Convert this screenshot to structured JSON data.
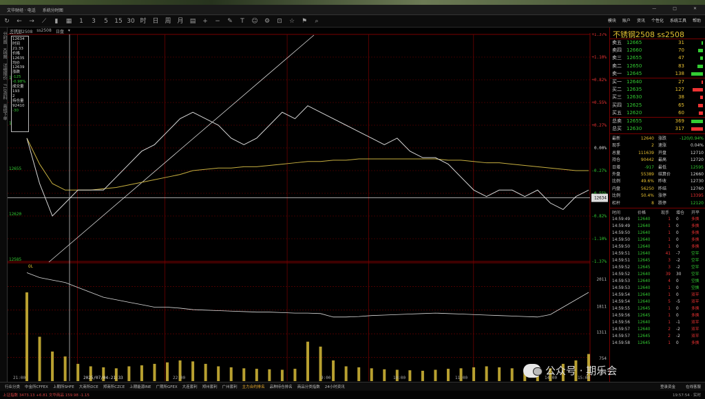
{
  "window": {
    "title": "文华财经 · 电话",
    "subtitle": "系统分时图",
    "controls": [
      "—",
      "□",
      "✕"
    ]
  },
  "topnav": [
    "模块",
    "账户",
    "资讯",
    "个性化",
    "系统工具",
    "帮助"
  ],
  "lefttabs": [
    "分时图",
    "K线图",
    "详细报价",
    "F10资料",
    "画线下单"
  ],
  "chart_header": {
    "name": "不锈钢2508",
    "code": "ss2508",
    "mode": "日盘"
  },
  "infobox": [
    "12634",
    "时间",
    "21:33",
    "价格",
    "12635",
    "均价",
    "12639",
    "涨跌",
    "-125",
    "-0.98%",
    "成交量",
    "193",
    "2",
    "持仓量",
    "92410",
    "-30"
  ],
  "price_axis_left": [
    "12760",
    "12725",
    "12690",
    "12655",
    "12620",
    "12585"
  ],
  "pct_axis_right": [
    "+1.37%",
    "+1.10%",
    "+0.82%",
    "+0.55%",
    "+0.27%",
    "0.00%",
    "-0.27%",
    "-0.55%",
    "-0.82%",
    "-1.10%",
    "-1.37%"
  ],
  "vol_axis_right": [
    "2011",
    "1811",
    "1311",
    "754",
    "667"
  ],
  "time_axis": [
    "21:00",
    "2025/07/04-21:33",
    "22:00",
    "9:00",
    "10:00",
    "11:00",
    "14:00",
    "15:00"
  ],
  "oi_label": "OL",
  "right_panel": {
    "title": "不锈钢2508  ss2508",
    "asks": [
      {
        "label": "卖五",
        "price": "12665",
        "qty": "31",
        "bar": 0.12
      },
      {
        "label": "卖四",
        "price": "12660",
        "qty": "70",
        "bar": 0.35
      },
      {
        "label": "卖三",
        "price": "12655",
        "qty": "47",
        "bar": 0.22
      },
      {
        "label": "卖二",
        "price": "12650",
        "qty": "83",
        "bar": 0.4
      },
      {
        "label": "卖一",
        "price": "12645",
        "qty": "138",
        "bar": 0.85
      }
    ],
    "bids": [
      {
        "label": "买一",
        "price": "12640",
        "qty": "27",
        "bar": 0.12
      },
      {
        "label": "买二",
        "price": "12635",
        "qty": "127",
        "bar": 0.75
      },
      {
        "label": "买三",
        "price": "12630",
        "qty": "38",
        "bar": 0.2
      },
      {
        "label": "买四",
        "price": "12625",
        "qty": "65",
        "bar": 0.35
      },
      {
        "label": "买五",
        "price": "12620",
        "qty": "60",
        "bar": 0.3
      }
    ],
    "totals": [
      {
        "label": "总卖",
        "price": "12655",
        "qty": "369",
        "color": "#3c3"
      },
      {
        "label": "总买",
        "price": "12630",
        "qty": "317",
        "color": "#e33"
      }
    ],
    "quote_left": [
      [
        "最新",
        "12640"
      ],
      [
        "现手",
        "2"
      ],
      [
        "总量",
        "111639"
      ],
      [
        "持仓",
        "90442"
      ],
      [
        "日增",
        "-917"
      ],
      [
        "外盘",
        "55389"
      ],
      [
        "比例",
        "49.6%"
      ],
      [
        "内盘",
        "56250"
      ],
      [
        "比例",
        "50.4%"
      ],
      [
        "杠杆",
        "8"
      ]
    ],
    "quote_right": [
      [
        "涨跌",
        "-120/0.94%"
      ],
      [
        "速涨",
        "0.04%"
      ],
      [
        "开盘",
        "12710"
      ],
      [
        "最高",
        "12720"
      ],
      [
        "最低",
        "12595"
      ],
      [
        "结算价",
        "12660"
      ],
      [
        "昨收",
        "12730"
      ],
      [
        "昨结",
        "12760"
      ],
      [
        "涨停",
        "13395"
      ],
      [
        "跌停",
        "12120"
      ]
    ],
    "ticks_header": [
      "时间",
      "价格",
      "现手",
      "增仓",
      "开平"
    ],
    "ticks": [
      [
        "14:59:49",
        "12640",
        "1",
        "0",
        "多换"
      ],
      [
        "14:59:49",
        "12640",
        "1",
        "0",
        "多换"
      ],
      [
        "14:59:50",
        "12640",
        "1",
        "0",
        "多换"
      ],
      [
        "14:59:50",
        "12640",
        "1",
        "0",
        "多换"
      ],
      [
        "14:59:50",
        "12640",
        "1",
        "0",
        "多换"
      ],
      [
        "14:59:51",
        "12640",
        "41",
        "-7",
        "空平"
      ],
      [
        "14:59:51",
        "12645",
        "3",
        "-2",
        "空平"
      ],
      [
        "14:59:52",
        "12645",
        "3",
        "-2",
        "空平"
      ],
      [
        "14:59:52",
        "12640",
        "39",
        "30",
        "空平"
      ],
      [
        "14:59:53",
        "12640",
        "4",
        "0",
        "空换"
      ],
      [
        "14:59:53",
        "12640",
        "1",
        "0",
        "空换"
      ],
      [
        "14:59:54",
        "12640",
        "1",
        "0",
        "双平"
      ],
      [
        "14:59:54",
        "12640",
        "5",
        "-5",
        "双平"
      ],
      [
        "14:59:55",
        "12645",
        "1",
        "0",
        "多换"
      ],
      [
        "14:59:56",
        "12645",
        "1",
        "0",
        "多换"
      ],
      [
        "14:59:56",
        "12640",
        "1",
        "-1",
        "双平"
      ],
      [
        "14:59:57",
        "12640",
        "2",
        "-2",
        "双平"
      ],
      [
        "14:59:57",
        "12645",
        "2",
        "-2",
        "双平"
      ],
      [
        "14:59:58",
        "12645",
        "1",
        "0",
        "多换"
      ]
    ]
  },
  "bottom_tabs": [
    "行业分类",
    "中金所CFFEX",
    "上期所SHFE",
    "大商所DCE",
    "郑商所CZCE",
    "上期能源INE",
    "广期所GFEX",
    "大连套利",
    "郑州套利",
    "广州套利",
    "主力合约排名",
    "品种持仓排名",
    "商品分类指数",
    "24小时资讯"
  ],
  "bottom_tab_active": 10,
  "bottom_right": [
    "登录资金",
    "在线客服"
  ],
  "statusbar": {
    "left": "上证指数 3473.13 +6.81   文华商品 159.98 -1.15",
    "right": "19:57:54 · 实时"
  },
  "watermark": "公众号 · 期乐会",
  "colors": {
    "price_line": "#d8d8d8",
    "avg_line": "#c8b040",
    "volume": "#b8a030",
    "grid_red": "#7a0000",
    "up": "#e33",
    "down": "#3c3",
    "accent": "#e0c030"
  },
  "chart_data": {
    "type": "line",
    "price_ylim": [
      12585,
      12760
    ],
    "base_price": 12730,
    "price": [
      12680,
      12645,
      12620,
      12630,
      12640,
      12640,
      12640,
      12650,
      12660,
      12670,
      12675,
      12685,
      12695,
      12700,
      12695,
      12690,
      12680,
      12675,
      12680,
      12690,
      12700,
      12695,
      12705,
      12700,
      12695,
      12690,
      12685,
      12680,
      12675,
      12680,
      12670,
      12665,
      12665,
      12660,
      12650,
      12640,
      12635,
      12640,
      12640,
      12635,
      12640,
      12630,
      12625,
      12635,
      12640
    ],
    "avg": [
      12680,
      12660,
      12645,
      12640,
      12640,
      12640,
      12641,
      12642,
      12644,
      12646,
      12648,
      12650,
      12652,
      12655,
      12656,
      12657,
      12657,
      12658,
      12658,
      12659,
      12660,
      12661,
      12662,
      12662,
      12663,
      12663,
      12664,
      12664,
      12664,
      12664,
      12664,
      12664,
      12664,
      12663,
      12663,
      12662,
      12661,
      12661,
      12660,
      12659,
      12658,
      12657,
      12656,
      12655,
      12655
    ],
    "oi": [
      2200,
      2100,
      2050,
      2000,
      1900,
      1800,
      1700,
      1650,
      1600,
      1550,
      1500,
      1500,
      1480,
      1450,
      1440,
      1430,
      1420,
      1410,
      1400,
      1400,
      1390,
      1380,
      1380,
      1370,
      1300,
      1300,
      1310,
      1330,
      1340,
      1350,
      1360,
      1370,
      1380,
      1370,
      1360,
      1350,
      1340,
      1330,
      1320,
      1310,
      1300,
      1350,
      1500,
      1650,
      1800
    ],
    "volume": [
      1800,
      900,
      600,
      500,
      350,
      300,
      280,
      260,
      300,
      320,
      350,
      380,
      420,
      400,
      350,
      300,
      280,
      260,
      250,
      240,
      230,
      250,
      800,
      700,
      420,
      300,
      280,
      260,
      240,
      230,
      220,
      210,
      230,
      250,
      260,
      280,
      300,
      280,
      260,
      240,
      230,
      260,
      350,
      420,
      550
    ]
  }
}
